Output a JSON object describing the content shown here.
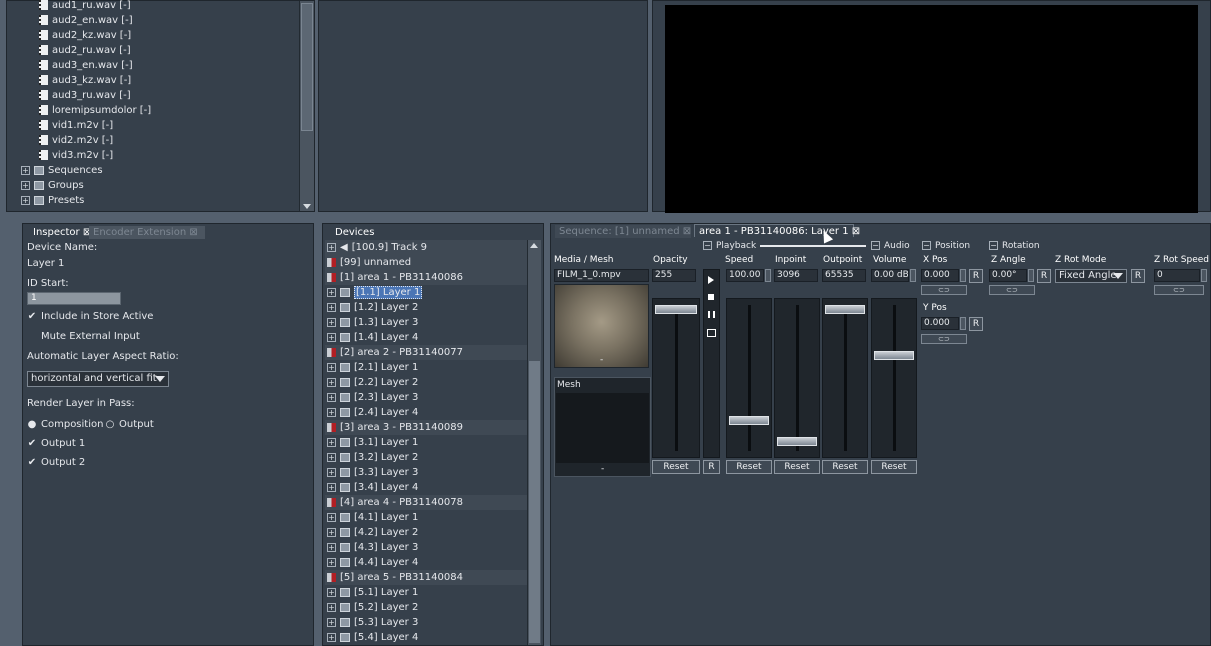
{
  "file_tree": {
    "items": [
      {
        "label": "aud1_ru.wav [-]",
        "icon": "audio-file-icon"
      },
      {
        "label": "aud2_en.wav [-]",
        "icon": "audio-file-icon"
      },
      {
        "label": "aud2_kz.wav [-]",
        "icon": "audio-file-icon"
      },
      {
        "label": "aud2_ru.wav [-]",
        "icon": "audio-file-icon"
      },
      {
        "label": "aud3_en.wav [-]",
        "icon": "audio-file-icon"
      },
      {
        "label": "aud3_kz.wav [-]",
        "icon": "audio-file-icon"
      },
      {
        "label": "aud3_ru.wav [-]",
        "icon": "audio-file-icon"
      },
      {
        "label": "loremipsumdolor [-]",
        "icon": "media-file-icon"
      },
      {
        "label": "vid1.m2v [-]",
        "icon": "video-file-icon"
      },
      {
        "label": "vid2.m2v [-]",
        "icon": "video-file-icon"
      },
      {
        "label": "vid3.m2v [-]",
        "icon": "video-file-icon"
      }
    ],
    "folders": [
      {
        "label": "Sequences",
        "icon": "sequences-folder-icon"
      },
      {
        "label": "Groups",
        "icon": "groups-folder-icon"
      },
      {
        "label": "Presets",
        "icon": "presets-folder-icon"
      }
    ]
  },
  "inspector": {
    "tab_active": "Inspector",
    "tab_inactive": "Encoder Extension",
    "device_name_label": "Device Name:",
    "device_name_value": "Layer 1",
    "id_start_label": "ID Start:",
    "id_start_value": "1",
    "include_store_label": "Include in Store Active",
    "include_store_checked": true,
    "mute_external_label": "Mute External Input",
    "mute_external_checked": false,
    "aspect_label": "Automatic Layer Aspect Ratio:",
    "aspect_value": "horizontal and vertical fit",
    "render_pass_label": "Render Layer in Pass:",
    "composition_label": "Composition",
    "output_radio_label": "Output",
    "composition_selected": true,
    "output1_label": "Output 1",
    "output1_checked": true,
    "output2_label": "Output 2",
    "output2_checked": true
  },
  "devices": {
    "tab_label": "Devices",
    "items": [
      {
        "label": "[100.9] Track 9",
        "type": "track",
        "selected": false
      },
      {
        "label": "[99] unnamed",
        "type": "area",
        "selected": false
      },
      {
        "label": "[1] area 1 - PB31140086",
        "type": "area",
        "selected": false
      },
      {
        "label": "[1.1] Layer 1",
        "type": "layer",
        "selected": true
      },
      {
        "label": "[1.2] Layer 2",
        "type": "layer",
        "selected": false
      },
      {
        "label": "[1.3] Layer 3",
        "type": "layer",
        "selected": false
      },
      {
        "label": "[1.4] Layer 4",
        "type": "layer",
        "selected": false
      },
      {
        "label": "[2] area 2 - PB31140077",
        "type": "area",
        "selected": false
      },
      {
        "label": "[2.1] Layer 1",
        "type": "layer",
        "selected": false
      },
      {
        "label": "[2.2] Layer 2",
        "type": "layer",
        "selected": false
      },
      {
        "label": "[2.3] Layer 3",
        "type": "layer",
        "selected": false
      },
      {
        "label": "[2.4] Layer 4",
        "type": "layer",
        "selected": false
      },
      {
        "label": "[3] area 3 - PB31140089",
        "type": "area",
        "selected": false
      },
      {
        "label": "[3.1] Layer 1",
        "type": "layer",
        "selected": false
      },
      {
        "label": "[3.2] Layer 2",
        "type": "layer",
        "selected": false
      },
      {
        "label": "[3.3] Layer 3",
        "type": "layer",
        "selected": false
      },
      {
        "label": "[3.4] Layer 4",
        "type": "layer",
        "selected": false
      },
      {
        "label": "[4] area 4 - PB31140078",
        "type": "area",
        "selected": false
      },
      {
        "label": "[4.1] Layer 1",
        "type": "layer",
        "selected": false
      },
      {
        "label": "[4.2] Layer 2",
        "type": "layer",
        "selected": false
      },
      {
        "label": "[4.3] Layer 3",
        "type": "layer",
        "selected": false
      },
      {
        "label": "[4.4] Layer 4",
        "type": "layer",
        "selected": false
      },
      {
        "label": "[5] area 5 - PB31140084",
        "type": "area",
        "selected": false
      },
      {
        "label": "[5.1] Layer 1",
        "type": "layer",
        "selected": false
      },
      {
        "label": "[5.2] Layer 2",
        "type": "layer",
        "selected": false
      },
      {
        "label": "[5.3] Layer 3",
        "type": "layer",
        "selected": false
      },
      {
        "label": "[5.4] Layer 4",
        "type": "layer",
        "selected": false
      }
    ]
  },
  "layer_panel": {
    "tab_inactive": "Sequence: [1] unnamed",
    "tab_active": "area 1 - PB31140086: Layer 1",
    "sections": {
      "playback": "Playback",
      "audio": "Audio",
      "position": "Position",
      "rotation": "Rotation"
    },
    "headers": {
      "media_mesh": "Media / Mesh",
      "opacity": "Opacity",
      "speed": "Speed",
      "inpoint": "Inpoint",
      "outpoint": "Outpoint",
      "volume": "Volume",
      "xpos": "X Pos",
      "zangle": "Z Angle",
      "zrotmode": "Z Rot Mode",
      "zrotspeed": "Z Rot Speed",
      "ypos": "Y Pos"
    },
    "values": {
      "media": "FILM_1_0.mpv",
      "opacity": "255",
      "speed": "100.00 %",
      "inpoint": "3096",
      "outpoint": "65535",
      "volume": "0.00 dB",
      "xpos": "0.000",
      "zangle": "0.00°",
      "zrotmode": "Fixed Angle",
      "zrotspeed": "0",
      "ypos": "0.000"
    },
    "media_dash": "-",
    "mesh_label": "Mesh",
    "mesh_dash": "-",
    "reset_label": "Reset",
    "r_label": "R",
    "sliders": {
      "opacity": 1.0,
      "speed": 0.2,
      "inpoint": 0.05,
      "outpoint": 1.0,
      "volume": 0.67
    }
  }
}
